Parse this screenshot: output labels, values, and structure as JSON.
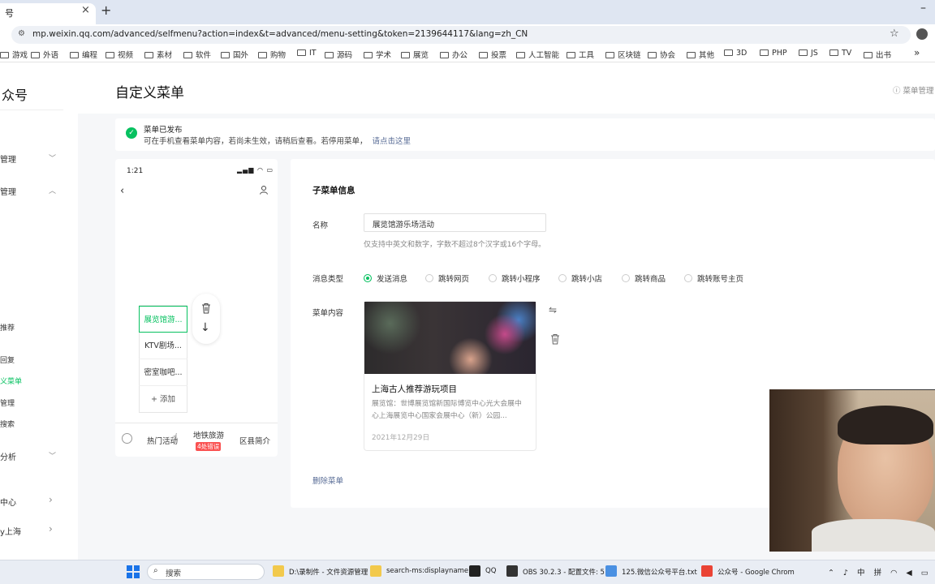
{
  "browser": {
    "tab_title": "号",
    "tab_close": "×",
    "new_tab": "+",
    "minimize": "–",
    "url": "mp.weixin.qq.com/advanced/selfmenu?action=index&t=advanced/menu-setting&token=2139644117&lang=zh_CN",
    "star": "☆",
    "more": "»",
    "bookmarks": [
      "游戏",
      "外语",
      "编程",
      "视频",
      "素材",
      "软件",
      "国外",
      "购物",
      "IT",
      "源码",
      "学术",
      "展览",
      "办公",
      "投票",
      "人工智能",
      "工具",
      "区块链",
      "协会",
      "其他",
      "3D",
      "PHP",
      "JS",
      "TV",
      "出书"
    ]
  },
  "sidebar": {
    "brand": "众号",
    "items": [
      {
        "label": "管理",
        "chevron": "﹀"
      },
      {
        "label": "管理",
        "chevron": "︿"
      },
      {
        "label": "推荐"
      },
      {
        "label": "回复"
      },
      {
        "label": "义菜单"
      },
      {
        "label": "管理"
      },
      {
        "label": "搜索"
      },
      {
        "label": "分析",
        "chevron": "﹀"
      },
      {
        "label": "中心",
        "chevron": "›"
      },
      {
        "label": "y上海",
        "chevron": "›"
      }
    ]
  },
  "header": {
    "title": "自定义菜单",
    "help": "菜单管理"
  },
  "notice": {
    "icon": "✓",
    "title": "菜单已发布",
    "desc": "可在手机查看菜单内容，若尚未生效，请稍后查看。若停用菜单，",
    "link": "请点击这里"
  },
  "phone": {
    "time": "1:21",
    "status": "▂▄▆ ◠ ▭",
    "back": "‹",
    "submenu": [
      "展览馆游...",
      "KTV剧场...",
      "密室咖吧..."
    ],
    "add_label": "+ 添加",
    "down": "↓",
    "tabs": [
      "热门活动",
      "地铁旅游",
      "区县简介"
    ],
    "tab_badge": "4处错误",
    "cursor": "☝"
  },
  "form": {
    "title": "子菜单信息",
    "name_label": "名称",
    "name_value": "展览馆游乐场活动",
    "name_hint": "仅支持中英文和数字，字数不超过8个汉字或16个字母。",
    "type_label": "消息类型",
    "types": [
      {
        "label": "发送消息",
        "selected": true
      },
      {
        "label": "跳转网页",
        "selected": false
      },
      {
        "label": "跳转小程序",
        "selected": false
      },
      {
        "label": "跳转小店",
        "selected": false
      },
      {
        "label": "跳转商品",
        "selected": false
      },
      {
        "label": "跳转账号主页",
        "selected": false
      }
    ],
    "content_label": "菜单内容",
    "card": {
      "title": "上海古人推荐游玩项目",
      "desc": "展览馆：世博展览馆新国际博览中心光大会展中心上海展览中心国家会展中心（新）公园...",
      "date": "2021年12月29日"
    },
    "swap": "⇋",
    "delete_label": "删除菜单"
  },
  "taskbar": {
    "search": "搜索",
    "items": [
      {
        "label": "D:\\录制件 - 文件资源管理",
        "color": "#f2c94c"
      },
      {
        "label": "search-ms:displayname",
        "color": "#f2c94c"
      },
      {
        "label": "QQ",
        "color": "#222222"
      },
      {
        "label": "OBS 30.2.3 - 配置文件: 5",
        "color": "#333333"
      },
      {
        "label": "125.微信公众号平台.txt",
        "color": "#4a90e2"
      },
      {
        "label": "公众号 - Google Chrom",
        "color": "#ea4335"
      }
    ],
    "tray": "⌃ ♪ 中 拼 ◠ ◀ ▭"
  },
  "colors": {
    "accent": "#07c160",
    "link": "#576b95",
    "error": "#fa5151"
  }
}
